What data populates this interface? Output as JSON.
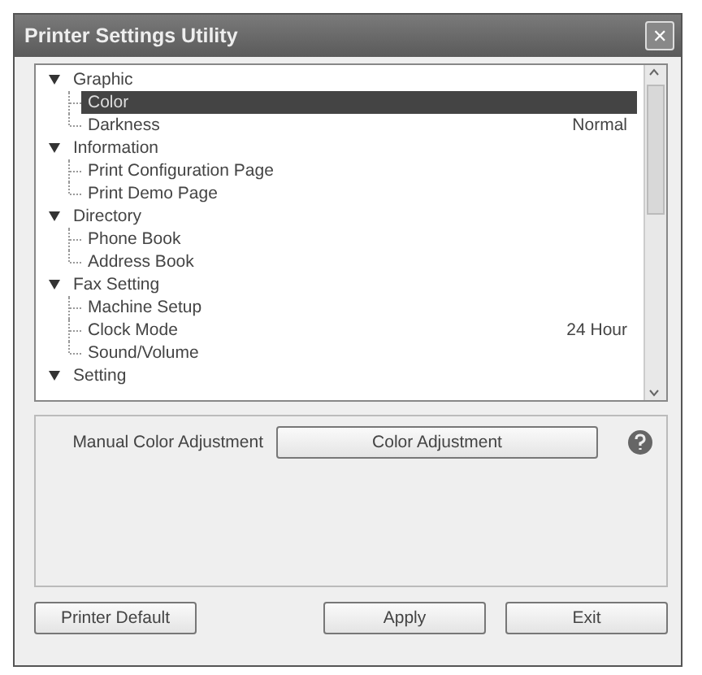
{
  "window": {
    "title": "Printer Settings Utility",
    "close": "✕"
  },
  "tree": [
    {
      "label": "Graphic",
      "expanded": true,
      "selected": false,
      "children": [
        {
          "label": "Color",
          "selected": true
        },
        {
          "label": "Darkness",
          "value": "Normal",
          "selected": false
        }
      ]
    },
    {
      "label": "Information",
      "expanded": true,
      "selected": false,
      "children": [
        {
          "label": "Print Configuration Page",
          "selected": false
        },
        {
          "label": "Print Demo Page",
          "selected": false
        }
      ]
    },
    {
      "label": "Directory",
      "expanded": true,
      "selected": false,
      "children": [
        {
          "label": "Phone Book",
          "selected": false
        },
        {
          "label": "Address Book",
          "selected": false
        }
      ]
    },
    {
      "label": "Fax Setting",
      "expanded": true,
      "selected": false,
      "children": [
        {
          "label": "Machine Setup",
          "selected": false
        },
        {
          "label": "Clock Mode",
          "value": "24 Hour",
          "selected": false
        },
        {
          "label": "Sound/Volume",
          "selected": false
        }
      ]
    },
    {
      "label": "Setting",
      "expanded": true,
      "selected": false
    }
  ],
  "detail": {
    "label": "Manual Color Adjustment",
    "button": "Color Adjustment"
  },
  "buttons": [
    {
      "label": "Printer Default",
      "kind": "left"
    },
    {
      "label": "Apply",
      "kind": "right"
    },
    {
      "label": "Exit",
      "kind": "right"
    }
  ]
}
